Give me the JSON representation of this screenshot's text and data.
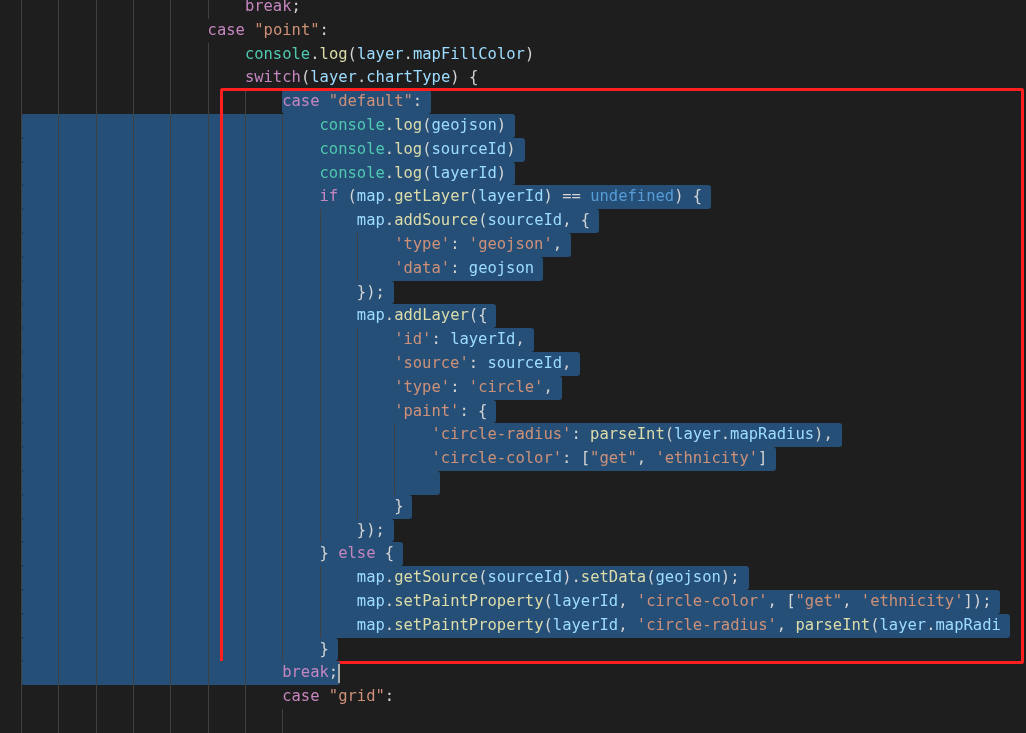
{
  "editor": {
    "lines": [
      {
        "children": [
          {
            "selected": false,
            "cursor": false,
            "framed": false,
            "tokens": [
              {
                "kind": "kw",
                "text": "break"
              },
              {
                "kind": "punc",
                "text": ";"
              }
            ]
          }
        ]
      },
      {
        "selected": false,
        "cursor": false,
        "framed": false,
        "tokens": [
          {
            "kind": "kw",
            "text": "case "
          },
          {
            "kind": "str",
            "text": "\"point\""
          },
          {
            "kind": "punc",
            "text": ":"
          }
        ],
        "children": [
          {
            "selected": false,
            "cursor": false,
            "framed": false,
            "tokens": [
              {
                "kind": "cls",
                "text": "console"
              },
              {
                "kind": "punc",
                "text": "."
              },
              {
                "kind": "fn",
                "text": "log"
              },
              {
                "kind": "punc",
                "text": "("
              },
              {
                "kind": "var",
                "text": "layer"
              },
              {
                "kind": "punc",
                "text": "."
              },
              {
                "kind": "var",
                "text": "mapFillColor"
              },
              {
                "kind": "punc",
                "text": ")"
              }
            ]
          },
          {
            "selected": false,
            "cursor": false,
            "framed": false,
            "tokens": [
              {
                "kind": "kw",
                "text": "switch"
              },
              {
                "kind": "punc",
                "text": "("
              },
              {
                "kind": "var",
                "text": "layer"
              },
              {
                "kind": "punc",
                "text": "."
              },
              {
                "kind": "var",
                "text": "chartType"
              },
              {
                "kind": "punc",
                "text": ") {"
              }
            ],
            "children": [
              {
                "selected": true,
                "cursor": false,
                "framed": true,
                "tokens": [
                  {
                    "kind": "kw",
                    "text": "case "
                  },
                  {
                    "kind": "str",
                    "text": "\"default\""
                  },
                  {
                    "kind": "punc",
                    "text": ":"
                  }
                ],
                "children": [
                  {
                    "selected": true,
                    "cursor": false,
                    "framed": true,
                    "tokens": [
                      {
                        "kind": "cls",
                        "text": "console"
                      },
                      {
                        "kind": "punc",
                        "text": "."
                      },
                      {
                        "kind": "fn",
                        "text": "log"
                      },
                      {
                        "kind": "punc",
                        "text": "("
                      },
                      {
                        "kind": "var",
                        "text": "geojson"
                      },
                      {
                        "kind": "punc",
                        "text": ")"
                      }
                    ]
                  },
                  {
                    "selected": true,
                    "cursor": false,
                    "framed": true,
                    "tokens": [
                      {
                        "kind": "cls",
                        "text": "console"
                      },
                      {
                        "kind": "punc",
                        "text": "."
                      },
                      {
                        "kind": "fn",
                        "text": "log"
                      },
                      {
                        "kind": "punc",
                        "text": "("
                      },
                      {
                        "kind": "var",
                        "text": "sourceId"
                      },
                      {
                        "kind": "punc",
                        "text": ")"
                      }
                    ]
                  },
                  {
                    "selected": true,
                    "cursor": false,
                    "framed": true,
                    "tokens": [
                      {
                        "kind": "cls",
                        "text": "console"
                      },
                      {
                        "kind": "punc",
                        "text": "."
                      },
                      {
                        "kind": "fn",
                        "text": "log"
                      },
                      {
                        "kind": "punc",
                        "text": "("
                      },
                      {
                        "kind": "var",
                        "text": "layerId"
                      },
                      {
                        "kind": "punc",
                        "text": ")"
                      }
                    ]
                  },
                  {
                    "selected": true,
                    "cursor": false,
                    "framed": true,
                    "tokens": [
                      {
                        "kind": "kw",
                        "text": "if"
                      },
                      {
                        "kind": "punc",
                        "text": " ("
                      },
                      {
                        "kind": "var",
                        "text": "map"
                      },
                      {
                        "kind": "punc",
                        "text": "."
                      },
                      {
                        "kind": "fn",
                        "text": "getLayer"
                      },
                      {
                        "kind": "punc",
                        "text": "("
                      },
                      {
                        "kind": "var",
                        "text": "layerId"
                      },
                      {
                        "kind": "punc",
                        "text": ") == "
                      },
                      {
                        "kind": "const",
                        "text": "undefined"
                      },
                      {
                        "kind": "punc",
                        "text": ") {"
                      }
                    ],
                    "children": [
                      {
                        "selected": true,
                        "cursor": false,
                        "framed": true,
                        "tokens": [
                          {
                            "kind": "var",
                            "text": "map"
                          },
                          {
                            "kind": "punc",
                            "text": "."
                          },
                          {
                            "kind": "fn",
                            "text": "addSource"
                          },
                          {
                            "kind": "punc",
                            "text": "("
                          },
                          {
                            "kind": "var",
                            "text": "sourceId"
                          },
                          {
                            "kind": "punc",
                            "text": ", {"
                          }
                        ],
                        "children": [
                          {
                            "selected": true,
                            "cursor": false,
                            "framed": true,
                            "tokens": [
                              {
                                "kind": "str",
                                "text": "'type'"
                              },
                              {
                                "kind": "punc",
                                "text": ": "
                              },
                              {
                                "kind": "str",
                                "text": "'geojson'"
                              },
                              {
                                "kind": "punc",
                                "text": ","
                              }
                            ]
                          },
                          {
                            "selected": true,
                            "cursor": false,
                            "framed": true,
                            "tokens": [
                              {
                                "kind": "str",
                                "text": "'data'"
                              },
                              {
                                "kind": "punc",
                                "text": ": "
                              },
                              {
                                "kind": "var",
                                "text": "geojson"
                              }
                            ]
                          }
                        ]
                      },
                      {
                        "selected": true,
                        "cursor": false,
                        "framed": true,
                        "tokens": [
                          {
                            "kind": "punc",
                            "text": "});"
                          }
                        ]
                      },
                      {
                        "selected": true,
                        "cursor": false,
                        "framed": true,
                        "tokens": [
                          {
                            "kind": "var",
                            "text": "map"
                          },
                          {
                            "kind": "punc",
                            "text": "."
                          },
                          {
                            "kind": "fn",
                            "text": "addLayer"
                          },
                          {
                            "kind": "punc",
                            "text": "({"
                          }
                        ],
                        "children": [
                          {
                            "selected": true,
                            "cursor": false,
                            "framed": true,
                            "tokens": [
                              {
                                "kind": "str",
                                "text": "'id'"
                              },
                              {
                                "kind": "punc",
                                "text": ": "
                              },
                              {
                                "kind": "var",
                                "text": "layerId"
                              },
                              {
                                "kind": "punc",
                                "text": ","
                              }
                            ]
                          },
                          {
                            "selected": true,
                            "cursor": false,
                            "framed": true,
                            "tokens": [
                              {
                                "kind": "str",
                                "text": "'source'"
                              },
                              {
                                "kind": "punc",
                                "text": ": "
                              },
                              {
                                "kind": "var",
                                "text": "sourceId"
                              },
                              {
                                "kind": "punc",
                                "text": ","
                              }
                            ]
                          },
                          {
                            "selected": true,
                            "cursor": false,
                            "framed": true,
                            "tokens": [
                              {
                                "kind": "str",
                                "text": "'type'"
                              },
                              {
                                "kind": "punc",
                                "text": ": "
                              },
                              {
                                "kind": "str",
                                "text": "'circle'"
                              },
                              {
                                "kind": "punc",
                                "text": ","
                              }
                            ]
                          },
                          {
                            "selected": true,
                            "cursor": false,
                            "framed": true,
                            "tokens": [
                              {
                                "kind": "str",
                                "text": "'paint'"
                              },
                              {
                                "kind": "punc",
                                "text": ": {"
                              }
                            ],
                            "children": [
                              {
                                "selected": true,
                                "cursor": false,
                                "framed": true,
                                "tokens": [
                                  {
                                    "kind": "str",
                                    "text": "'circle-radius'"
                                  },
                                  {
                                    "kind": "punc",
                                    "text": ": "
                                  },
                                  {
                                    "kind": "fn",
                                    "text": "parseInt"
                                  },
                                  {
                                    "kind": "punc",
                                    "text": "("
                                  },
                                  {
                                    "kind": "var",
                                    "text": "layer"
                                  },
                                  {
                                    "kind": "punc",
                                    "text": "."
                                  },
                                  {
                                    "kind": "var",
                                    "text": "mapRadius"
                                  },
                                  {
                                    "kind": "punc",
                                    "text": "),"
                                  }
                                ]
                              },
                              {
                                "selected": true,
                                "cursor": false,
                                "framed": true,
                                "tokens": [
                                  {
                                    "kind": "str",
                                    "text": "'circle-color'"
                                  },
                                  {
                                    "kind": "punc",
                                    "text": ": ["
                                  },
                                  {
                                    "kind": "str",
                                    "text": "\"get\""
                                  },
                                  {
                                    "kind": "punc",
                                    "text": ", "
                                  },
                                  {
                                    "kind": "str",
                                    "text": "'ethnicity'"
                                  },
                                  {
                                    "kind": "punc",
                                    "text": "]"
                                  }
                                ]
                              },
                              {
                                "selected": true,
                                "cursor": false,
                                "framed": true
                              }
                            ]
                          },
                          {
                            "selected": true,
                            "cursor": false,
                            "framed": true,
                            "tokens": [
                              {
                                "kind": "punc",
                                "text": "}"
                              }
                            ]
                          }
                        ]
                      },
                      {
                        "selected": true,
                        "cursor": false,
                        "framed": true,
                        "tokens": [
                          {
                            "kind": "punc",
                            "text": "});"
                          }
                        ]
                      }
                    ]
                  },
                  {
                    "selected": true,
                    "cursor": false,
                    "framed": true,
                    "tokens": [
                      {
                        "kind": "punc",
                        "text": "} "
                      },
                      {
                        "kind": "kw",
                        "text": "else"
                      },
                      {
                        "kind": "punc",
                        "text": " {"
                      }
                    ],
                    "children": [
                      {
                        "selected": true,
                        "cursor": false,
                        "framed": true,
                        "tokens": [
                          {
                            "kind": "var",
                            "text": "map"
                          },
                          {
                            "kind": "punc",
                            "text": "."
                          },
                          {
                            "kind": "fn",
                            "text": "getSource"
                          },
                          {
                            "kind": "punc",
                            "text": "("
                          },
                          {
                            "kind": "var",
                            "text": "sourceId"
                          },
                          {
                            "kind": "punc",
                            "text": ")."
                          },
                          {
                            "kind": "fn",
                            "text": "setData"
                          },
                          {
                            "kind": "punc",
                            "text": "("
                          },
                          {
                            "kind": "var",
                            "text": "geojson"
                          },
                          {
                            "kind": "punc",
                            "text": ");"
                          }
                        ]
                      },
                      {
                        "selected": true,
                        "cursor": false,
                        "framed": true,
                        "tokens": [
                          {
                            "kind": "var",
                            "text": "map"
                          },
                          {
                            "kind": "punc",
                            "text": "."
                          },
                          {
                            "kind": "fn",
                            "text": "setPaintProperty"
                          },
                          {
                            "kind": "punc",
                            "text": "("
                          },
                          {
                            "kind": "var",
                            "text": "layerId"
                          },
                          {
                            "kind": "punc",
                            "text": ", "
                          },
                          {
                            "kind": "str",
                            "text": "'circle-color'"
                          },
                          {
                            "kind": "punc",
                            "text": ", ["
                          },
                          {
                            "kind": "str",
                            "text": "\"get\""
                          },
                          {
                            "kind": "punc",
                            "text": ", "
                          },
                          {
                            "kind": "str",
                            "text": "'ethnicity'"
                          },
                          {
                            "kind": "punc",
                            "text": "]);"
                          }
                        ]
                      },
                      {
                        "selected": true,
                        "cursor": false,
                        "framed": true,
                        "tokens": [
                          {
                            "kind": "var",
                            "text": "map"
                          },
                          {
                            "kind": "punc",
                            "text": "."
                          },
                          {
                            "kind": "fn",
                            "text": "setPaintProperty"
                          },
                          {
                            "kind": "punc",
                            "text": "("
                          },
                          {
                            "kind": "var",
                            "text": "layerId"
                          },
                          {
                            "kind": "punc",
                            "text": ", "
                          },
                          {
                            "kind": "str",
                            "text": "'circle-radius'"
                          },
                          {
                            "kind": "punc",
                            "text": ", "
                          },
                          {
                            "kind": "fn",
                            "text": "parseInt"
                          },
                          {
                            "kind": "punc",
                            "text": "("
                          },
                          {
                            "kind": "var",
                            "text": "layer"
                          },
                          {
                            "kind": "punc",
                            "text": "."
                          },
                          {
                            "kind": "var",
                            "text": "mapRadi"
                          }
                        ]
                      }
                    ]
                  },
                  {
                    "selected": true,
                    "cursor": false,
                    "framed": true,
                    "tokens": [
                      {
                        "kind": "punc",
                        "text": "}"
                      }
                    ]
                  }
                ]
              },
              {
                "selected": true,
                "cursor": true,
                "framed": false,
                "tokens": [
                  {
                    "kind": "kw",
                    "text": "break"
                  },
                  {
                    "kind": "punc",
                    "text": ";"
                  }
                ]
              },
              {
                "selected": false,
                "cursor": false,
                "framed": false,
                "tokens": [
                  {
                    "kind": "kw",
                    "text": "case "
                  },
                  {
                    "kind": "str",
                    "text": "\"grid\""
                  },
                  {
                    "kind": "punc",
                    "text": ":"
                  }
                ],
                "children": [
                  {
                    "selected": false,
                    "cursor": false,
                    "framed": false
                  }
                ]
              }
            ]
          }
        ]
      }
    ]
  }
}
